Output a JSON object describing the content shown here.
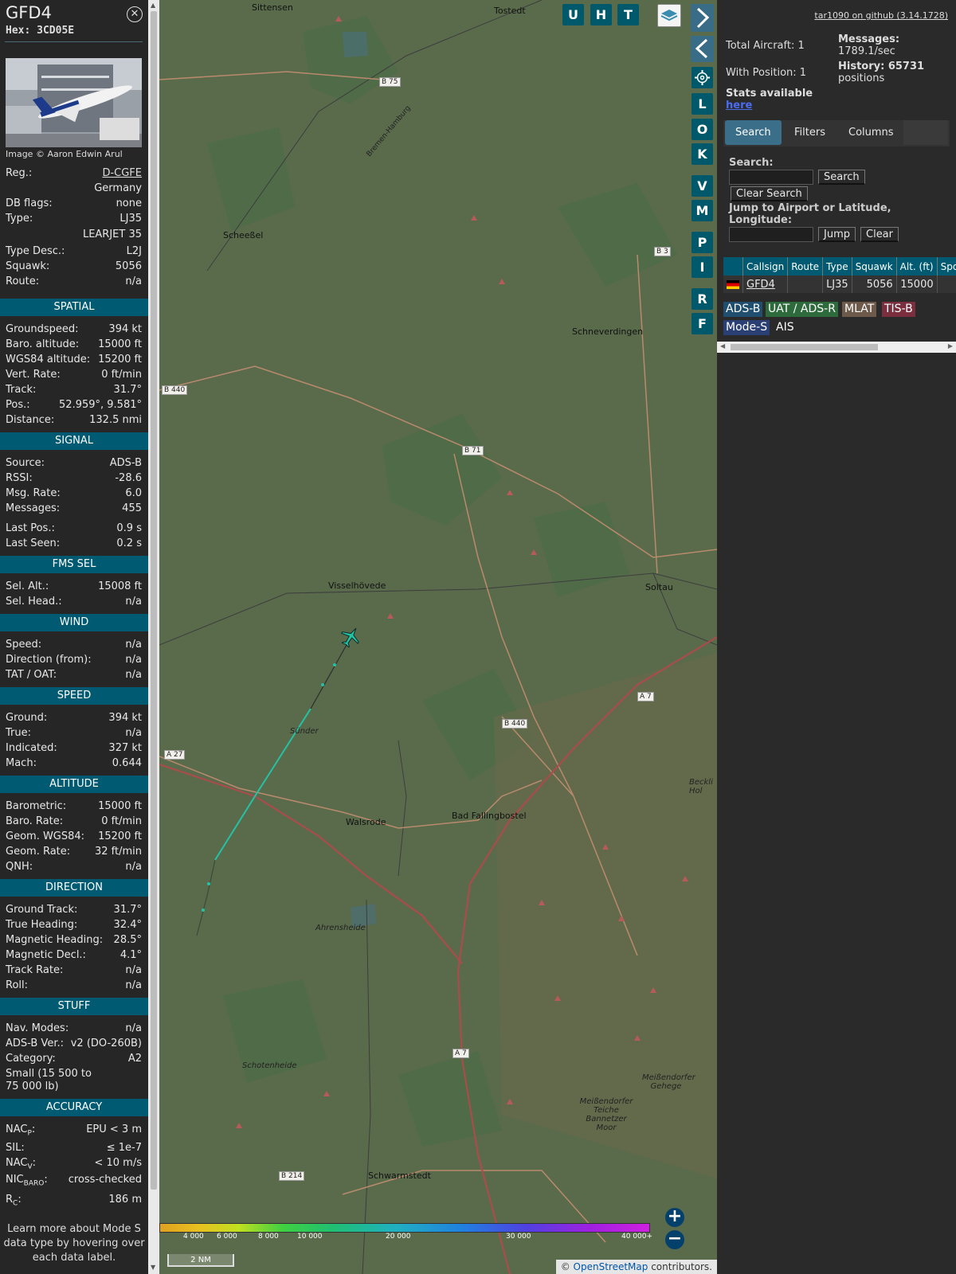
{
  "info": {
    "title": "GFD4",
    "hex": "Hex: 3CD05E",
    "image_credit": "Image © Aaron Edwin Arul",
    "reg_label": "Reg.:",
    "reg_value": "D-CGFE",
    "country": "Germany",
    "db_flags_label": "DB flags:",
    "db_flags_value": "none",
    "type_label": "Type:",
    "type_value": "LJ35",
    "type_full": "LEARJET 35",
    "type_desc_label": "Type Desc.:",
    "type_desc_value": "L2J",
    "squawk_label": "Squawk:",
    "squawk_value": "5056",
    "route_label": "Route:",
    "route_value": "n/a",
    "sections": {
      "spatial": "SPATIAL",
      "signal": "SIGNAL",
      "fms": "FMS SEL",
      "wind": "WIND",
      "speed": "SPEED",
      "altitude": "ALTITUDE",
      "direction": "DIRECTION",
      "stuff": "STUFF",
      "accuracy": "ACCURACY"
    },
    "spatial": [
      {
        "k": "Groundspeed:",
        "v": "394 kt"
      },
      {
        "k": "Baro. altitude:",
        "v": "15000 ft"
      },
      {
        "k": "WGS84 altitude:",
        "v": "15200 ft"
      },
      {
        "k": "Vert. Rate:",
        "v": "0 ft/min"
      },
      {
        "k": "Track:",
        "v": "31.7°"
      },
      {
        "k": "Pos.:",
        "v": "52.959°, 9.581°"
      },
      {
        "k": "Distance:",
        "v": "132.5 nmi"
      }
    ],
    "signal": [
      {
        "k": "Source:",
        "v": "ADS-B"
      },
      {
        "k": "RSSI:",
        "v": "-28.6"
      },
      {
        "k": "Msg. Rate:",
        "v": "6.0"
      },
      {
        "k": "Messages:",
        "v": "455"
      },
      {
        "k": "Last Pos.:",
        "v": "0.9 s"
      },
      {
        "k": "Last Seen:",
        "v": "0.2 s"
      }
    ],
    "fms": [
      {
        "k": "Sel. Alt.:",
        "v": "15008 ft"
      },
      {
        "k": "Sel. Head.:",
        "v": "n/a"
      }
    ],
    "wind": [
      {
        "k": "Speed:",
        "v": "n/a"
      },
      {
        "k": "Direction (from):",
        "v": "n/a"
      },
      {
        "k": "TAT / OAT:",
        "v": "n/a"
      }
    ],
    "speed": [
      {
        "k": "Ground:",
        "v": "394 kt"
      },
      {
        "k": "True:",
        "v": "n/a"
      },
      {
        "k": "Indicated:",
        "v": "327 kt"
      },
      {
        "k": "Mach:",
        "v": "0.644"
      }
    ],
    "altitude": [
      {
        "k": "Barometric:",
        "v": "15000 ft"
      },
      {
        "k": "Baro. Rate:",
        "v": "0 ft/min"
      },
      {
        "k": "Geom. WGS84:",
        "v": "15200 ft"
      },
      {
        "k": "Geom. Rate:",
        "v": "32 ft/min"
      },
      {
        "k": "QNH:",
        "v": "n/a"
      }
    ],
    "direction": [
      {
        "k": "Ground Track:",
        "v": "31.7°"
      },
      {
        "k": "True Heading:",
        "v": "32.4°"
      },
      {
        "k": "Magnetic Heading:",
        "v": "28.5°"
      },
      {
        "k": "Magnetic Decl.:",
        "v": "4.1°"
      },
      {
        "k": "Track Rate:",
        "v": "n/a"
      },
      {
        "k": "Roll:",
        "v": "n/a"
      }
    ],
    "stuff": [
      {
        "k": "Nav. Modes:",
        "v": "n/a"
      },
      {
        "k": "ADS-B Ver.:",
        "v": "v2 (DO-260B)"
      },
      {
        "k": "Category:",
        "v": "A2"
      }
    ],
    "category_desc_1": "Small (15 500 to",
    "category_desc_2": "75 000 lb)",
    "accuracy": {
      "nacp_label": "NAC",
      "nacp_sub": "P",
      "nacp_value": "EPU < 3 m",
      "sil_label": "SIL:",
      "sil_value": "≤ 1e-7",
      "nacv_label": "NAC",
      "nacv_sub": "V",
      "nacv_value": "< 10 m/s",
      "nicbaro_label": "NIC",
      "nicbaro_sub": "BARO",
      "nicbaro_value": "cross-checked",
      "rc_label": "R",
      "rc_sub": "C",
      "rc_value": "186 m"
    },
    "footer": "Learn more about Mode S data type by hovering over each data label."
  },
  "map": {
    "buttons": [
      "U",
      "H",
      "T"
    ],
    "side_buttons": [
      "L",
      "O",
      "K",
      "V",
      "M",
      "P",
      "I",
      "R",
      "F"
    ],
    "places": [
      "Sittensen",
      "Tostedt",
      "Scheeßel",
      "Schneverdingen",
      "Visselhövede",
      "Soltau",
      "Walsrode",
      "Bad Fallingbostel",
      "Ahrensheide",
      "Schotenheide",
      "Schwarmstedt",
      "Meißendorfer Gehege",
      "Meißendorfer Teiche Bannetzer Moor",
      "Beckli Hol",
      "Bremen-Hamburg",
      "Sünder"
    ],
    "roads": [
      "B 75",
      "B 3",
      "B 440",
      "B 71",
      "A 7",
      "B 440",
      "A 27",
      "A 7",
      "B 214",
      "B 214"
    ],
    "alt_scale": [
      "4 000",
      "6 000",
      "8 000",
      "10 000",
      "20 000",
      "30 000",
      "40 000+"
    ],
    "scale_bar": "2 NM",
    "attribution_prefix": "© ",
    "attribution_link": "OpenStreetMap",
    "attribution_suffix": " contributors."
  },
  "right": {
    "github": "tar1090 on github (3.14.1728)",
    "total_aircraft": "Total Aircraft: 1",
    "with_position": "With Position: 1",
    "messages_label": "Messages:",
    "messages_value": "1789.1/sec",
    "history_label": "History: 65731",
    "history_value": "positions",
    "stats_available": "Stats available",
    "stats_link": "here",
    "tabs": [
      "Search",
      "Filters",
      "Columns"
    ],
    "search_label": "Search:",
    "search_btn": "Search",
    "clear_search_btn": "Clear Search",
    "jump_label": "Jump to Airport or Latitude, Longitude:",
    "jump_btn": "Jump",
    "clear_btn": "Clear",
    "table_headers": [
      "",
      "Callsign",
      "Route",
      "Type",
      "Squawk",
      "Alt. (ft)",
      "Spd."
    ],
    "table_row": {
      "callsign": "GFD4",
      "route": "",
      "type": "LJ35",
      "squawk": "5056",
      "alt": "15000",
      "spd": ""
    },
    "legend": [
      {
        "label": "ADS-B",
        "color": "#1f4e6e"
      },
      {
        "label": "UAT / ADS-R",
        "color": "#2e6b3c"
      },
      {
        "label": "MLAT",
        "color": "#6e5a4a"
      },
      {
        "label": "TIS-B",
        "color": "#7a2e3e"
      },
      {
        "label": "Mode-S",
        "color": "#2a3f74"
      },
      {
        "label": "AIS",
        "color": ""
      }
    ]
  }
}
